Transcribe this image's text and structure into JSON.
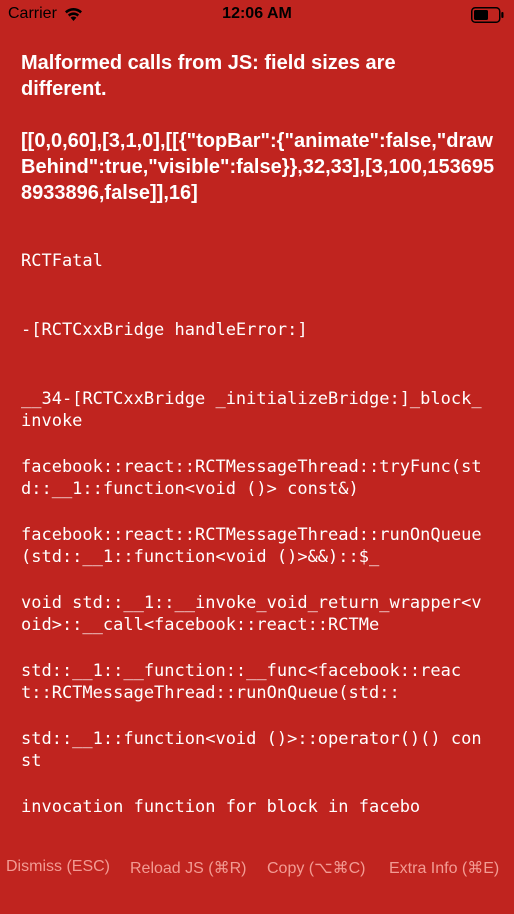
{
  "status_bar": {
    "carrier": "Carrier",
    "time": "12:06 AM",
    "icons": [
      "wifi-icon",
      "battery-icon"
    ],
    "text_color": "#000000"
  },
  "error": {
    "message": "Malformed calls from JS: field sizes are different.",
    "detail": "[[0,0,60],[3,1,0],[[{\"topBar\":{\"animate\":false,\"drawBehind\":true,\"visible\":false}},32,33],[3,100,1536958933896,false]],16]"
  },
  "stack": [
    "RCTFatal",
    "-[RCTCxxBridge handleError:]",
    "__34-[RCTCxxBridge _initializeBridge:]_block_invoke",
    "facebook::react::RCTMessageThread::tryFunc(std::__1::function<void ()> const&)",
    "facebook::react::RCTMessageThread::runOnQueue(std::__1::function<void ()>&&)::$_",
    "void std::__1::__invoke_void_return_wrapper<void>::__call<facebook::react::RCTMe",
    "std::__1::__function::__func<facebook::react::RCTMessageThread::runOnQueue(std::",
    "std::__1::function<void ()>::operator()() const",
    "invocation function for block in facebo"
  ],
  "buttons": {
    "dismiss": "Dismiss (ESC)",
    "reload": "Reload JS (⌘R)",
    "copy": "Copy (⌥⌘C)",
    "extra_info": "Extra Info (⌘E)"
  },
  "colors": {
    "background": "#c0241f",
    "text": "#ffffff",
    "button_text": "#f29b93"
  }
}
